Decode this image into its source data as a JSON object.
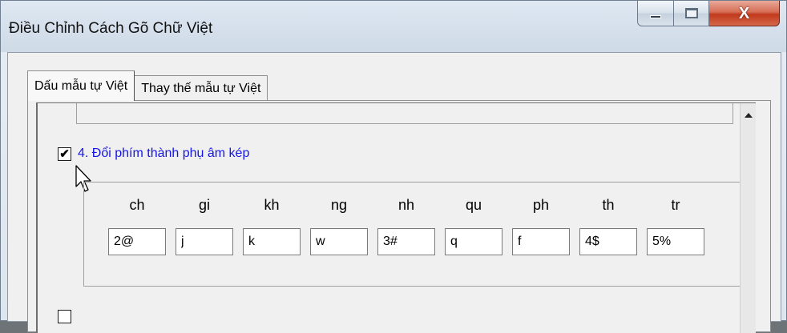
{
  "window": {
    "title": "Điều Chỉnh Cách Gõ Chữ Việt",
    "close_glyph": "X"
  },
  "tabs": [
    {
      "label": "Dấu mẫu tự Việt",
      "active": true
    },
    {
      "label": "Thay thế mẫu tự Việt",
      "active": false
    }
  ],
  "section4": {
    "checked": true,
    "check_glyph": "✔",
    "label": "4. Đổi phím thành phụ âm kép",
    "columns": [
      {
        "label": "ch",
        "value": "2@"
      },
      {
        "label": "gi",
        "value": "j"
      },
      {
        "label": "kh",
        "value": "k"
      },
      {
        "label": "ng",
        "value": "w"
      },
      {
        "label": "nh",
        "value": "3#"
      },
      {
        "label": "qu",
        "value": "q"
      },
      {
        "label": "ph",
        "value": "f"
      },
      {
        "label": "th",
        "value": "4$"
      },
      {
        "label": "tr",
        "value": "5%"
      }
    ]
  },
  "colors": {
    "label_blue": "#1515e6",
    "close_red": "#c2391c"
  },
  "icons": [
    "minimize-icon",
    "maximize-icon",
    "close-icon",
    "checkmark-icon",
    "mouse-pointer-icon",
    "scroll-up-arrow-icon"
  ]
}
